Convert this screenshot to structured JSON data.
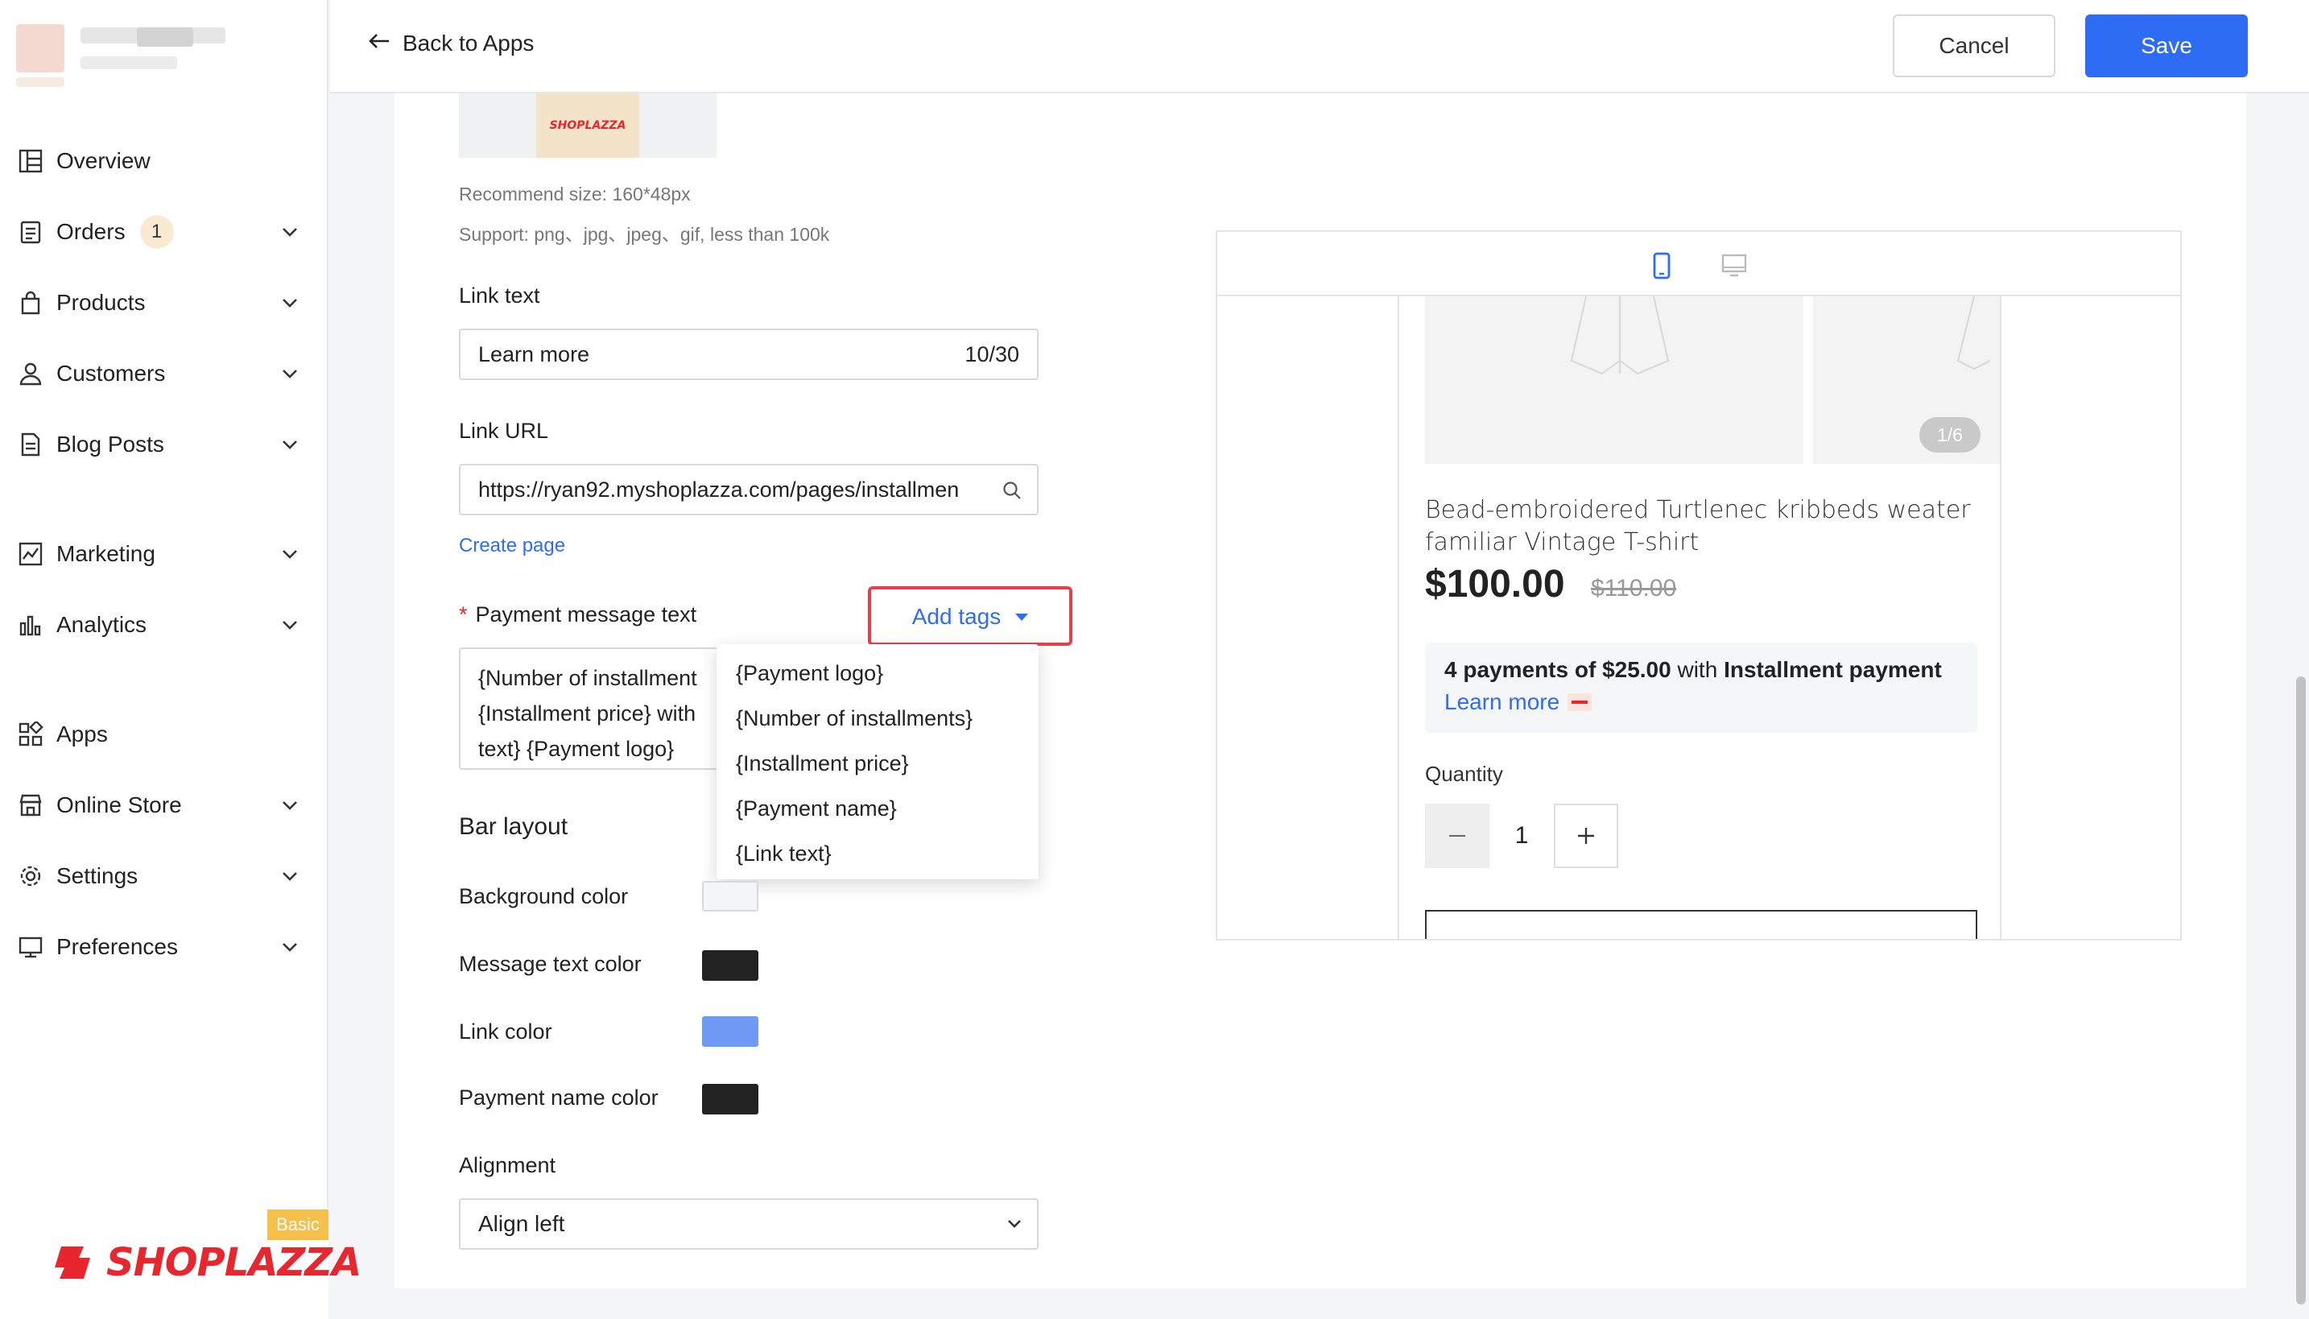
{
  "sidebar": {
    "items": [
      {
        "label": "Overview",
        "icon": "overview-icon",
        "expandable": false
      },
      {
        "label": "Orders",
        "icon": "orders-icon",
        "expandable": true,
        "badge": "1"
      },
      {
        "label": "Products",
        "icon": "products-icon",
        "expandable": true
      },
      {
        "label": "Customers",
        "icon": "customers-icon",
        "expandable": true
      },
      {
        "label": "Blog Posts",
        "icon": "blog-posts-icon",
        "expandable": true
      },
      {
        "label": "Marketing",
        "icon": "marketing-icon",
        "expandable": true
      },
      {
        "label": "Analytics",
        "icon": "analytics-icon",
        "expandable": true
      },
      {
        "label": "Apps",
        "icon": "apps-icon",
        "expandable": false
      },
      {
        "label": "Online Store",
        "icon": "online-store-icon",
        "expandable": true
      },
      {
        "label": "Settings",
        "icon": "settings-icon",
        "expandable": true
      },
      {
        "label": "Preferences",
        "icon": "preferences-icon",
        "expandable": true
      }
    ],
    "plan_badge": "Basic",
    "brand": "SHOPLAZZA"
  },
  "header": {
    "back_label": "Back to Apps",
    "cancel_label": "Cancel",
    "save_label": "Save"
  },
  "form": {
    "logo_preview_text": "SHOPLAZZA",
    "recommend_size": "Recommend size: 160*48px",
    "support_formats": "Support: png、jpg、jpeg、gif, less than 100k",
    "link_text_label": "Link text",
    "link_text_value": "Learn more",
    "link_text_count": "10/30",
    "link_url_label": "Link URL",
    "link_url_value": "https://ryan92.myshoplazza.com/pages/installmen",
    "create_page": "Create page",
    "payment_message_label": "Payment message text",
    "add_tags_label": "Add tags",
    "payment_message_lines": [
      "{Number of installment",
      "{Installment price} with",
      "text} {Payment logo}"
    ],
    "tags_dropdown": [
      "{Payment logo}",
      "{Number of installments}",
      "{Installment price}",
      "{Payment name}",
      "{Link text}"
    ],
    "bar_layout_title": "Bar layout",
    "background_color_label": "Background color",
    "message_text_color_label": "Message text color",
    "link_color_label": "Link color",
    "payment_name_color_label": "Payment name color",
    "alignment_label": "Alignment",
    "alignment_value": "Align left"
  },
  "colors": {
    "background": "#f4f5f7",
    "message_text": "#222222",
    "link": "#6f9bf7",
    "payment_name": "#222222",
    "accent": "#2f6cf4",
    "highlight_frame": "#e8404a"
  },
  "preview": {
    "pager": "1/6",
    "product_title": "Bead-embroidered Turtlenec kribbeds weater familiar Vintage T-shirt",
    "price": "$100.00",
    "compare_price": "$110.00",
    "installment_prefix": "4 payments of",
    "installment_amount": "$25.00",
    "installment_with": "with",
    "installment_name": "Installment payment",
    "learn_more": "Learn more",
    "quantity_label": "Quantity",
    "quantity_value": "1"
  }
}
